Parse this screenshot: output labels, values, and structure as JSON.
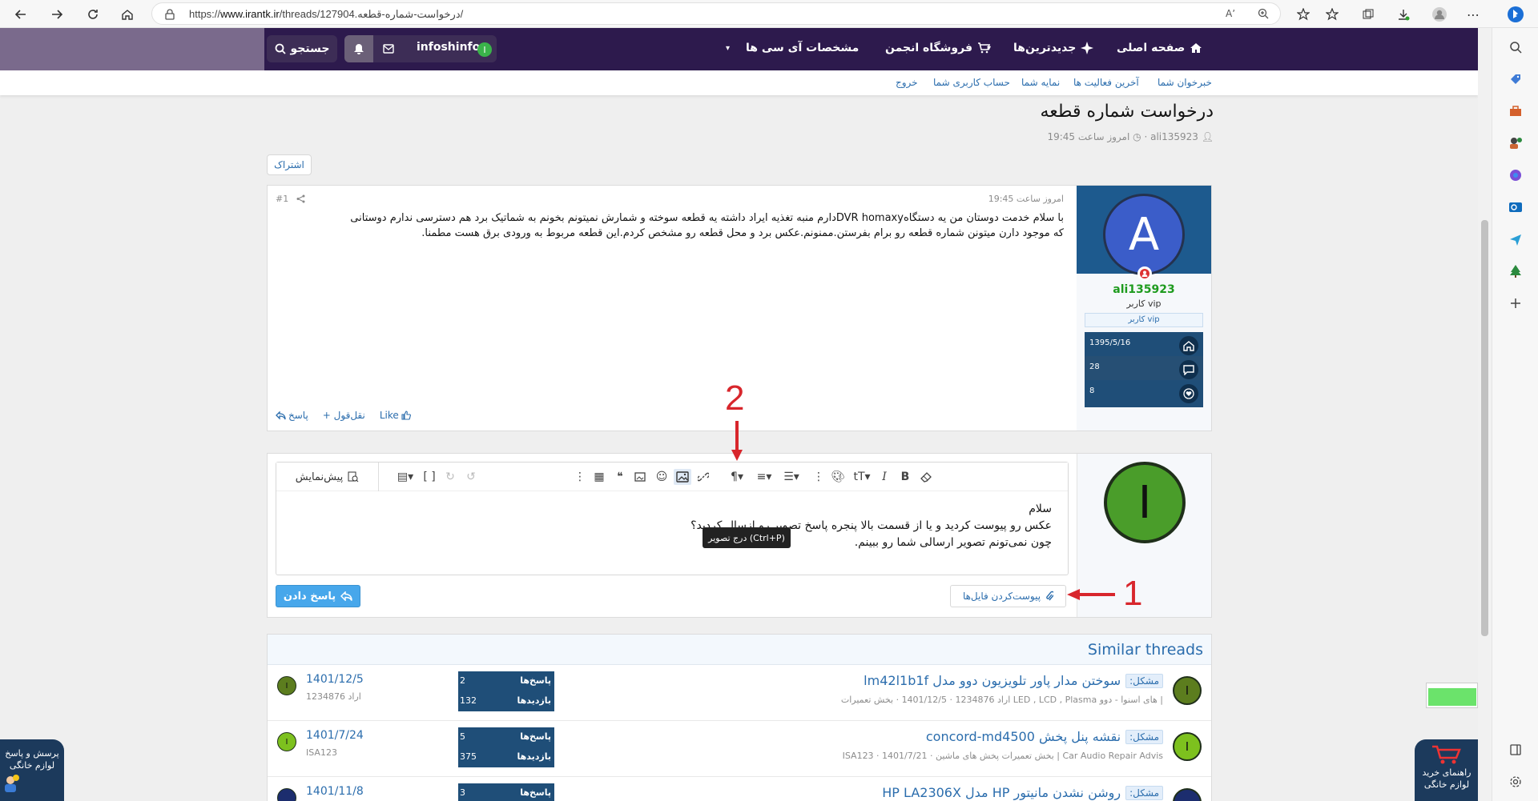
{
  "browser": {
    "url_prefix": "https://",
    "url_host": "www.irantk.ir",
    "url_path": "/threads/127904.درخواست-شماره-قطعه/",
    "read_aloud": "Aʼ"
  },
  "nav": {
    "home": "صفحه اصلی",
    "newest": "جدیدترین‌ها",
    "shop": "فروشگاه انجمن",
    "pc_specs": "مشخصات آی سی ها",
    "username": "infoshinfo",
    "user_avatar_letter": "I",
    "search": "جستجو"
  },
  "sub_nav": {
    "news_feed": "خبرخوان شما",
    "latest_activity": "آخرین فعالیت ها",
    "profile": "نمایه شما",
    "account": "حساب کاربری شما",
    "logout": "خروج"
  },
  "thread": {
    "title": "درخواست شماره قطعه",
    "author": "ali135923",
    "time": "امروز ساعت 19:45",
    "share": "اشتراک"
  },
  "post": {
    "date": "امروز ساعت 19:45",
    "number": "#1",
    "body_line1": "با سلام خدمت دوستان من یه دستگاهDVR homaxyدارم منبه تغذیه ایراد داشته یه قطعه سوخته و شمارش نمیتونم بخونم به شماتیک برد هم دسترسی ندارم دوستانی",
    "body_line2": "که موجود دارن میتونن شماره قطعه رو برام بفرستن.ممنونم.عکس برد و محل قطعه رو مشخص کردم.این قطعه مربوط به ورودی برق هست مطمنا.",
    "like": "Like",
    "quote": "+ نقل‌قول",
    "reply": "پاسخ"
  },
  "poster": {
    "avatar_letter": "A",
    "name": "ali135923",
    "title": "کاربر vip",
    "banner": "کاربر vip",
    "joined": "1395/5/16",
    "messages": "28",
    "reactions": "8"
  },
  "reply_editor": {
    "avatar_letter": "I",
    "preview": "پیش‌نمایش",
    "tooltip": "درج تصویر (Ctrl+P)",
    "line1": "سلام",
    "line2": "عکس رو پیوست کردید و یا از قسمت بالا پنجره پاسخ تصویر رو ازسال کردید؟",
    "line3": "چون نمی‌تونم تصویر ارسالی شما رو ببینم.",
    "submit": "پاسخ دادن",
    "attach": "پیوست‌کردن فایل‌ها"
  },
  "annotations": {
    "one": "1",
    "two": "2"
  },
  "similar": {
    "title": "Similar threads",
    "rows": [
      {
        "avatar_letter": "I",
        "avatar_color": "#5c7d1e",
        "prefix": "مشکل:",
        "title": "سوختن مدار پاور تلویزیون دوو مدل lm42l1b1f",
        "sub": "اراد 1234876 · 1401/12/5 · بخش تعمیرات LED , LCD , Plasma های اسنوا - دوو |",
        "replies": "2",
        "views": "132",
        "replies_label": "پاسخ‌ها",
        "views_label": "بازدیدها",
        "last_date": "1401/12/5",
        "last_user": "اراد 1234876"
      },
      {
        "avatar_letter": "I",
        "avatar_color": "#7dc11e",
        "prefix": "مشکل:",
        "title": "نقشه پنل پخش concord-md4500",
        "sub": "ISA123 · 1401/7/21 · بخش تعمیرات پخش های ماشین | Car Audio Repair Advis",
        "replies": "5",
        "views": "375",
        "replies_label": "پاسخ‌ها",
        "views_label": "بازدیدها",
        "last_date": "1401/7/24",
        "last_user": "ISA123"
      },
      {
        "avatar_letter": "",
        "avatar_color": "#1c2d6e",
        "prefix": "مشکل:",
        "title": "روشن نشدن مانیتور HP مدل HP LA2306X",
        "sub": "",
        "replies": "3",
        "views": "",
        "replies_label": "پاسخ‌ها",
        "views_label": "",
        "last_date": "1401/11/8",
        "last_user": ""
      }
    ]
  },
  "floating": {
    "left_line1": "پرسش و پاسخ",
    "left_line2": "لوازم خانگی",
    "right_line1": "راهنمای خرید",
    "right_line2": "لوازم خانگی"
  },
  "colors": {
    "nav_bg": "#2d1a4d",
    "link": "#2b6dad",
    "accent_button": "#47a7eb",
    "annotation_red": "#d8262c",
    "poster_name": "#1e9b1e"
  }
}
